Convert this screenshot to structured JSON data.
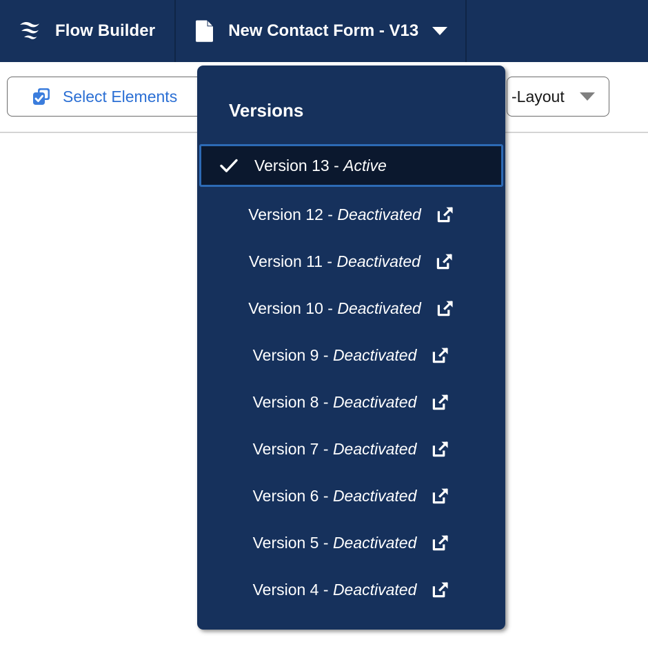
{
  "header": {
    "app_logo_icon": "flow-waves-logo",
    "app_title": "Flow Builder",
    "flow_doc_icon": "document-icon",
    "flow_title": "New Contact Form - V13",
    "flow_caret_icon": "chevron-down-icon"
  },
  "toolbar": {
    "select_elements_icon": "select-elements-icon",
    "select_elements_label": "Select Elements",
    "layout_label": "-Layout",
    "layout_caret_icon": "chevron-down-icon"
  },
  "versions_popup": {
    "heading": "Versions",
    "check_icon": "check-icon",
    "external_link_icon": "external-link-icon",
    "items": [
      {
        "name": "Version 13",
        "separator": " - ",
        "status": "Active",
        "active": true,
        "has_external_link": false
      },
      {
        "name": "Version 12",
        "separator": " - ",
        "status": "Deactivated",
        "active": false,
        "has_external_link": true
      },
      {
        "name": "Version 11",
        "separator": " - ",
        "status": "Deactivated",
        "active": false,
        "has_external_link": true
      },
      {
        "name": "Version 10",
        "separator": " - ",
        "status": "Deactivated",
        "active": false,
        "has_external_link": true
      },
      {
        "name": "Version 9",
        "separator": " - ",
        "status": "Deactivated",
        "active": false,
        "has_external_link": true
      },
      {
        "name": "Version 8",
        "separator": " - ",
        "status": "Deactivated",
        "active": false,
        "has_external_link": true
      },
      {
        "name": "Version 7",
        "separator": " - ",
        "status": "Deactivated",
        "active": false,
        "has_external_link": true
      },
      {
        "name": "Version 6",
        "separator": " - ",
        "status": "Deactivated",
        "active": false,
        "has_external_link": true
      },
      {
        "name": "Version 5",
        "separator": " - ",
        "status": "Deactivated",
        "active": false,
        "has_external_link": true
      },
      {
        "name": "Version 4",
        "separator": " - ",
        "status": "Deactivated",
        "active": false,
        "has_external_link": true
      }
    ]
  },
  "colors": {
    "header_bg": "#16315c",
    "popup_bg": "#16315c",
    "active_row_bg": "#0b182e",
    "active_row_border": "#2d6ab5",
    "link_blue": "#2b6fd4",
    "canvas_bg": "#ffffff"
  }
}
